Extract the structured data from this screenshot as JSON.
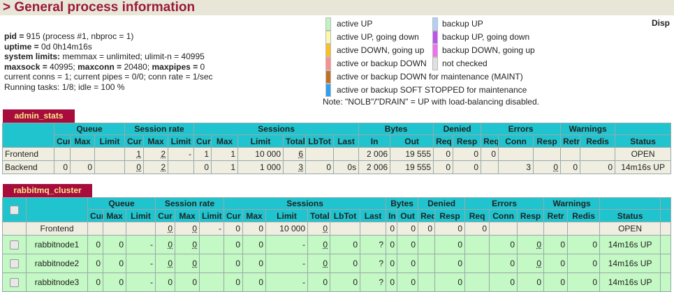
{
  "title": "> General process information",
  "info": {
    "l1b": "pid = ",
    "l1": "915 (process #1, nbproc = 1)",
    "l2b": "uptime = ",
    "l2": "0d 0h14m16s",
    "l3b": "system limits:",
    "l3": " memmax = unlimited; ulimit-n = 40995",
    "l4b1": "maxsock = ",
    "l4a": "40995; ",
    "l4b2": "maxconn = ",
    "l4c": "20480; ",
    "l4b3": "maxpipes = ",
    "l4d": "0",
    "l5": "current conns = 1; current pipes = 0/0; conn rate = 1/sec",
    "l6": "Running tasks: 1/8; idle = 100 %"
  },
  "legend": {
    "left": [
      {
        "label": "active UP",
        "color": "#c0f4c0"
      },
      {
        "label": "active UP, going down",
        "color": "#fcf8a8"
      },
      {
        "label": "active DOWN, going up",
        "color": "#f8c020"
      },
      {
        "label": "active or backup DOWN",
        "color": "#f89090"
      },
      {
        "label": "active or backup DOWN for maintenance (MAINT)",
        "color": "#c07020"
      },
      {
        "label": "active or backup SOFT STOPPED for maintenance",
        "color": "#2ea0f0"
      }
    ],
    "right": [
      {
        "label": "backup UP",
        "color": "#b0d0f8"
      },
      {
        "label": "backup UP, going down",
        "color": "#c050f0"
      },
      {
        "label": "backup DOWN, going up",
        "color": "#f070f0"
      },
      {
        "label": "not checked",
        "color": "#e0e0e0"
      }
    ],
    "note": "Note: \"NOLB\"/\"DRAIN\" = UP with load-balancing disabled."
  },
  "disp": "Disp",
  "groups": [
    "Queue",
    "Session rate",
    "Sessions",
    "Bytes",
    "Denied",
    "Errors",
    "Warnings"
  ],
  "subheaders": [
    "Cur",
    "Max",
    "Limit",
    "Cur",
    "Max",
    "Limit",
    "Cur",
    "Max",
    "Limit",
    "Total",
    "LbTot",
    "Last",
    "In",
    "Out",
    "Req",
    "Resp",
    "Req",
    "Conn",
    "Resp",
    "Retr",
    "Redis",
    "Status"
  ],
  "admin_stats": {
    "name": "admin_stats",
    "rows": [
      [
        "Frontend",
        "",
        "",
        "",
        "1",
        "2",
        "-",
        "1",
        "1",
        "10 000",
        "6",
        "",
        "",
        "2 006",
        "19 555",
        "0",
        "0",
        "0",
        "",
        "",
        "",
        "",
        "OPEN"
      ],
      [
        "Backend",
        "0",
        "0",
        "",
        "0",
        "2",
        "",
        "0",
        "1",
        "1 000",
        "3",
        "0",
        "0s",
        "2 006",
        "19 555",
        "0",
        "0",
        "",
        "3",
        "0",
        "0",
        "0",
        "14m16s UP"
      ]
    ]
  },
  "rabbitmq_cluster": {
    "name": "rabbitmq_cluster",
    "rows": [
      [
        "Frontend",
        "",
        "",
        "",
        "0",
        "0",
        "-",
        "0",
        "0",
        "10 000",
        "0",
        "",
        "",
        "0",
        "0",
        "0",
        "0",
        "0",
        "",
        "",
        "",
        "",
        "OPEN"
      ],
      [
        "rabbitnode1",
        "0",
        "0",
        "-",
        "0",
        "0",
        "",
        "0",
        "0",
        "-",
        "0",
        "0",
        "?",
        "0",
        "0",
        "",
        "0",
        "",
        "0",
        "0",
        "0",
        "0",
        "14m16s UP"
      ],
      [
        "rabbitnode2",
        "0",
        "0",
        "-",
        "0",
        "0",
        "",
        "0",
        "0",
        "-",
        "0",
        "0",
        "?",
        "0",
        "0",
        "",
        "0",
        "",
        "0",
        "0",
        "0",
        "0",
        "14m16s UP"
      ],
      [
        "rabbitnode3",
        "0",
        "0",
        "-",
        "0",
        "0",
        "",
        "0",
        "0",
        "-",
        "0",
        "0",
        "?",
        "0",
        "0",
        "",
        "0",
        "",
        "0",
        "0",
        "0",
        "0",
        "14m16s UP"
      ]
    ]
  }
}
